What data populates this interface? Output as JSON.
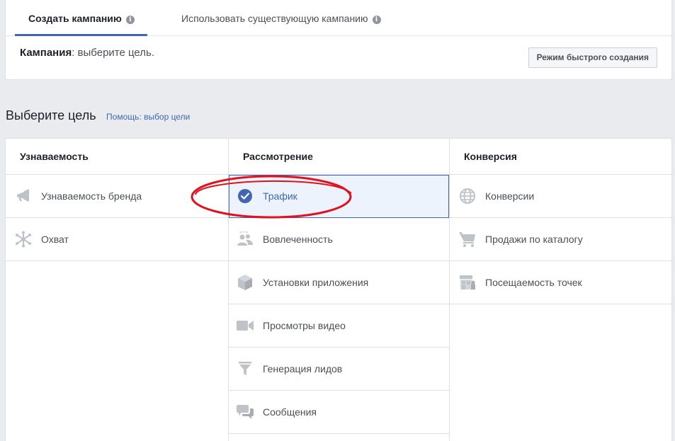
{
  "tabs": {
    "create": "Создать кампанию",
    "existing": "Использовать существующую кампанию"
  },
  "campaign": {
    "label": "Кампания",
    "text": ": выберите цель."
  },
  "quick_mode_button": "Режим быстрого создания",
  "objective": {
    "title": "Выберите цель",
    "help_link": "Помощь: выбор цели"
  },
  "columns": [
    {
      "header": "Узнаваемость",
      "items": [
        {
          "label": "Узнаваемость бренда",
          "icon": "megaphone-icon"
        },
        {
          "label": "Охват",
          "icon": "reach-icon"
        }
      ]
    },
    {
      "header": "Рассмотрение",
      "items": [
        {
          "label": "Трафик",
          "icon": "check-circle-icon",
          "selected": true
        },
        {
          "label": "Вовлеченность",
          "icon": "people-icon"
        },
        {
          "label": "Установки приложения",
          "icon": "box-icon"
        },
        {
          "label": "Просмотры видео",
          "icon": "video-camera-icon"
        },
        {
          "label": "Генерация лидов",
          "icon": "funnel-icon"
        },
        {
          "label": "Сообщения",
          "icon": "chat-bubbles-icon"
        }
      ]
    },
    {
      "header": "Конверсия",
      "items": [
        {
          "label": "Конверсии",
          "icon": "globe-icon"
        },
        {
          "label": "Продажи по каталогу",
          "icon": "shopping-cart-icon"
        },
        {
          "label": "Посещаемость точек",
          "icon": "store-icon"
        }
      ]
    }
  ],
  "colors": {
    "accent": "#4267b2",
    "selected_bg": "#ecf3fc",
    "icon_gray": "#bec3c9",
    "annotation_red": "#e0121e"
  }
}
